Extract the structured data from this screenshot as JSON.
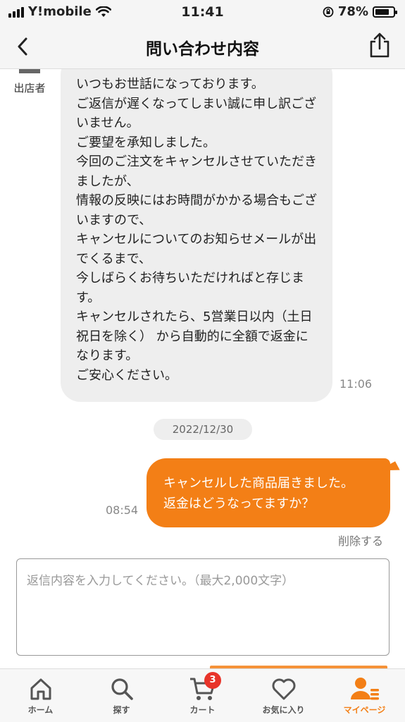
{
  "status_bar": {
    "carrier": "Y!mobile",
    "time": "11:41",
    "battery": "78%",
    "battery_level": 0.78
  },
  "nav": {
    "title": "問い合わせ内容"
  },
  "shop": {
    "label": "出店者"
  },
  "messages": {
    "incoming": {
      "text": "いつもお世話になっております。\nご返信が遅くなってしまい誠に申し訳ございません。\nご要望を承知しました。\n今回のご注文をキャンセルさせていただきましたが、\n情報の反映にはお時間がかかる場合もございますので、\nキャンセルについてのお知らせメールが出でくるまで、\n今しばらくお待ちいただければと存じます。\nキャンセルされたら、5営業日以内（土日祝日を除く） から自動的に全額で返金になります。\nご安心ください。",
      "time": "11:06"
    },
    "date_divider": "2022/12/30",
    "outgoing": {
      "text": "キャンセルした商品届きました。\n返金はどうなってますか？",
      "time": "08:54",
      "delete_label": "削除する"
    }
  },
  "reply": {
    "placeholder": "返信内容を入力してください。（最大2,000文字）"
  },
  "tabs": [
    {
      "label": "ホーム",
      "icon": "home-icon"
    },
    {
      "label": "探す",
      "icon": "search-icon"
    },
    {
      "label": "カート",
      "icon": "cart-icon",
      "badge": "3"
    },
    {
      "label": "お気に入り",
      "icon": "heart-icon"
    },
    {
      "label": "マイページ",
      "icon": "user-icon",
      "active": true
    }
  ],
  "colors": {
    "accent": "#f37f16",
    "badge": "#e8342a"
  }
}
